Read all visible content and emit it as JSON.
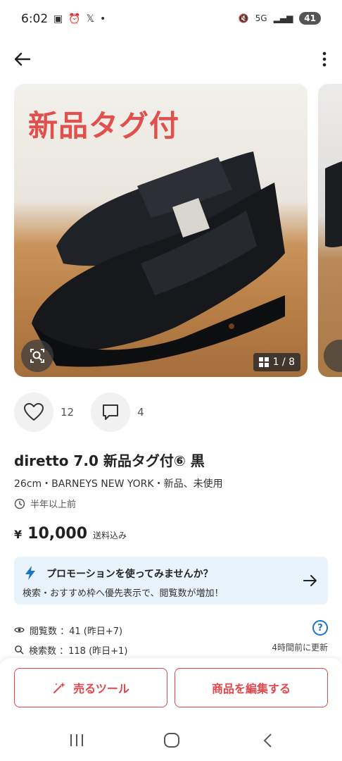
{
  "status_bar": {
    "time": "6:02",
    "network": "5G",
    "battery": "41"
  },
  "listing": {
    "image_overlay_text": "新品タグ付",
    "image_counter": "1 / 8",
    "likes": "12",
    "comments": "4",
    "title": "diretto 7.0 新品タグ付⑥ 黒",
    "subtitle": "26cm・BARNEYS NEW YORK・新品、未使用",
    "posted": "半年以上前",
    "price_currency": "¥",
    "price": "10,000",
    "shipping": "送料込み"
  },
  "promo": {
    "title": "プロモーションを使ってみませんか？",
    "subtitle": "検索・おすすめ枠へ優先表示で、閲覧数が増加！"
  },
  "stats": {
    "views": "閲覧数 ：41 (昨日+7)",
    "searches": "検索数 ：118 (昨日+1)",
    "updated": "4時間前に更新"
  },
  "actions": {
    "sell_tool": "売るツール",
    "edit_item": "商品を編集する"
  },
  "colors": {
    "accent_red": "#e0474c",
    "promo_bg": "#e9f3fb",
    "link_blue": "#1a73c4"
  }
}
